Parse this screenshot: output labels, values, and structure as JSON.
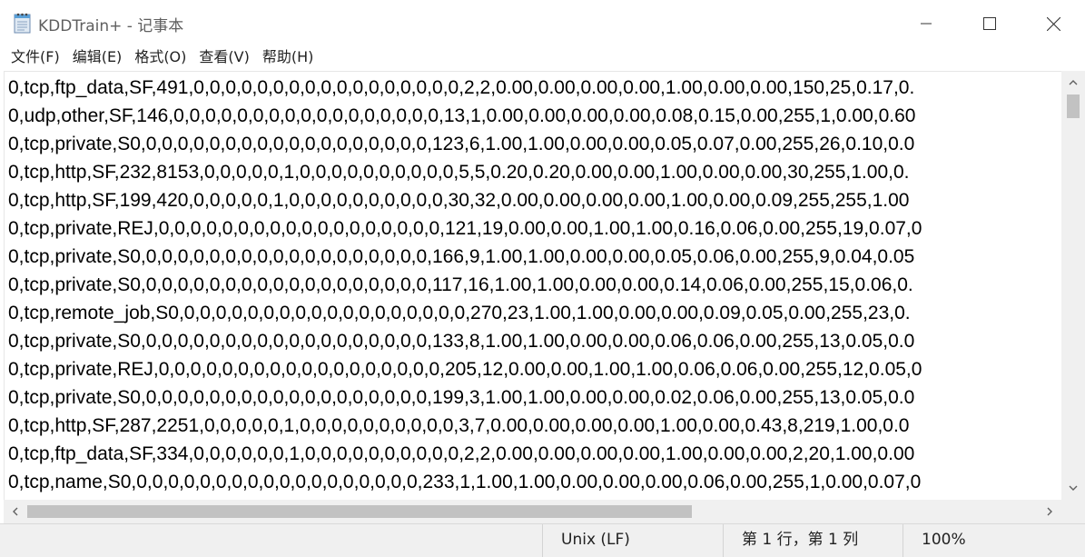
{
  "window": {
    "title": "KDDTrain+ - 记事本",
    "icon": "notepad-icon",
    "controls": [
      "minimize-icon",
      "maximize-icon",
      "close-icon"
    ]
  },
  "menu": [
    {
      "label": "文件(F)"
    },
    {
      "label": "编辑(E)"
    },
    {
      "label": "格式(O)"
    },
    {
      "label": "查看(V)"
    },
    {
      "label": "帮助(H)"
    }
  ],
  "editor": {
    "lines": [
      "0,tcp,ftp_data,SF,491,0,0,0,0,0,0,0,0,0,0,0,0,0,0,0,0,0,2,2,0.00,0.00,0.00,0.00,1.00,0.00,0.00,150,25,0.17,0.",
      "0,udp,other,SF,146,0,0,0,0,0,0,0,0,0,0,0,0,0,0,0,0,0,13,1,0.00,0.00,0.00,0.00,0.08,0.15,0.00,255,1,0.00,0.60",
      "0,tcp,private,S0,0,0,0,0,0,0,0,0,0,0,0,0,0,0,0,0,0,0,123,6,1.00,1.00,0.00,0.00,0.05,0.07,0.00,255,26,0.10,0.0",
      "0,tcp,http,SF,232,8153,0,0,0,0,0,1,0,0,0,0,0,0,0,0,0,0,5,5,0.20,0.20,0.00,0.00,1.00,0.00,0.00,30,255,1.00,0.",
      "0,tcp,http,SF,199,420,0,0,0,0,0,1,0,0,0,0,0,0,0,0,0,0,30,32,0.00,0.00,0.00,0.00,1.00,0.00,0.09,255,255,1.00",
      "0,tcp,private,REJ,0,0,0,0,0,0,0,0,0,0,0,0,0,0,0,0,0,0,121,19,0.00,0.00,1.00,1.00,0.16,0.06,0.00,255,19,0.07,0",
      "0,tcp,private,S0,0,0,0,0,0,0,0,0,0,0,0,0,0,0,0,0,0,0,166,9,1.00,1.00,0.00,0.00,0.05,0.06,0.00,255,9,0.04,0.05",
      "0,tcp,private,S0,0,0,0,0,0,0,0,0,0,0,0,0,0,0,0,0,0,0,117,16,1.00,1.00,0.00,0.00,0.14,0.06,0.00,255,15,0.06,0.",
      "0,tcp,remote_job,S0,0,0,0,0,0,0,0,0,0,0,0,0,0,0,0,0,0,0,270,23,1.00,1.00,0.00,0.00,0.09,0.05,0.00,255,23,0.",
      "0,tcp,private,S0,0,0,0,0,0,0,0,0,0,0,0,0,0,0,0,0,0,0,133,8,1.00,1.00,0.00,0.00,0.06,0.06,0.00,255,13,0.05,0.0",
      "0,tcp,private,REJ,0,0,0,0,0,0,0,0,0,0,0,0,0,0,0,0,0,0,205,12,0.00,0.00,1.00,1.00,0.06,0.06,0.00,255,12,0.05,0",
      "0,tcp,private,S0,0,0,0,0,0,0,0,0,0,0,0,0,0,0,0,0,0,0,199,3,1.00,1.00,0.00,0.00,0.02,0.06,0.00,255,13,0.05,0.0",
      "0,tcp,http,SF,287,2251,0,0,0,0,0,1,0,0,0,0,0,0,0,0,0,0,3,7,0.00,0.00,0.00,0.00,1.00,0.00,0.43,8,219,1.00,0.0",
      "0,tcp,ftp_data,SF,334,0,0,0,0,0,0,1,0,0,0,0,0,0,0,0,0,0,2,2,0.00,0.00,0.00,0.00,1.00,0.00,0.00,2,20,1.00,0.00",
      "0,tcp,name,S0,0,0,0,0,0,0,0,0,0,0,0,0,0,0,0,0,0,0,233,1,1.00,1.00,0.00,0.00,0.00,0.06,0.00,255,1,0.00,0.07,0"
    ]
  },
  "statusbar": {
    "line_ending": "Unix (LF)",
    "position": "第 1 行，第 1 列",
    "zoom": "100%"
  },
  "colors": {
    "background": "#ffffff",
    "chrome": "#f0f0f0",
    "scroll_thumb": "#c2c2c2",
    "text": "#000000"
  }
}
